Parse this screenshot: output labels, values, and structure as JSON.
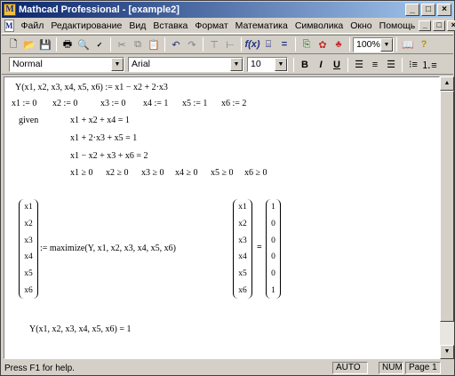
{
  "window": {
    "title": "Mathcad Professional - [example2]"
  },
  "title_buttons": {
    "minimize": "_",
    "maximize": "□",
    "close": "×"
  },
  "menu": [
    "Файл",
    "Редактирование",
    "Вид",
    "Вставка",
    "Формат",
    "Математика",
    "Символика",
    "Окно",
    "Помощь"
  ],
  "toolbar": {
    "zoom": "100%"
  },
  "format_bar": {
    "style": "Normal",
    "font": "Arial",
    "size": "10",
    "bold": "B",
    "italic": "I",
    "underline": "U"
  },
  "worksheet": {
    "def_Y": "Y(x1, x2, x3, x4, x5, x6) := x1 − x2 + 2·x3",
    "inits": [
      "x1 := 0",
      "x2 := 0",
      "x3 := 0",
      "x4 := 1",
      "x5 := 1",
      "x6 := 2"
    ],
    "given": "given",
    "constraints": [
      "x1 + x2 + x4 = 1",
      "x1 + 2·x3 + x5 = 1",
      "x1 − x2 + x3 + x6 = 2"
    ],
    "nonneg": [
      "x1 ≥ 0",
      "x2 ≥ 0",
      "x3 ≥ 0",
      "x4 ≥ 0",
      "x5 ≥ 0",
      "x6 ≥ 0"
    ],
    "left_vector": [
      "x1",
      "x2",
      "x3",
      "x4",
      "x5",
      "x6"
    ],
    "maximize_expr": ":= maximize(Y, x1, x2, x3, x4, x5, x6)",
    "result_vars": [
      "x1",
      "x2",
      "x3",
      "x4",
      "x5",
      "x6"
    ],
    "result_eq": "=",
    "result_values": [
      "1",
      "0",
      "0",
      "0",
      "0",
      "1"
    ],
    "y_result": "Y(x1, x2, x3, x4, x5, x6) = 1"
  },
  "status": {
    "help": "Press F1 for help.",
    "auto": "AUTO",
    "num": "NUM",
    "page": "Page 1"
  }
}
